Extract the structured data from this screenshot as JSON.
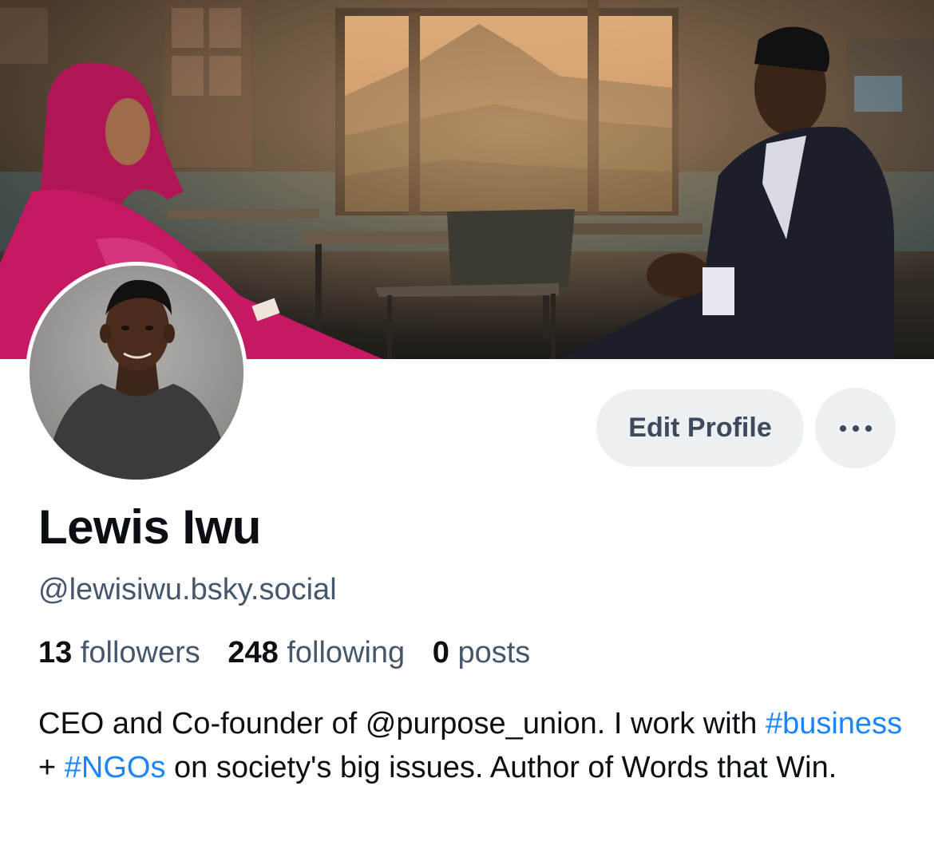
{
  "profile": {
    "display_name": "Lewis Iwu",
    "handle": "@lewisiwu.bsky.social",
    "edit_button_label": "Edit Profile",
    "more_button_label": "•••",
    "stats": {
      "followers_count": "13",
      "followers_label": "followers",
      "following_count": "248",
      "following_label": "following",
      "posts_count": "0",
      "posts_label": "posts"
    },
    "bio": {
      "line_part1": "CEO and Co-founder of @purpose_union. I work with ",
      "tag_business": "#business",
      "plus": " + ",
      "tag_ngos": "#NGOs",
      "line_part2": " on society's big issues. Author of Words that Win."
    }
  },
  "colors": {
    "accent_link": "#1a85ff",
    "button_bg": "#edf0f3",
    "secondary_text": "#46566b",
    "primary_text": "#0b0f14"
  },
  "icons": {
    "more": "ellipsis-icon"
  }
}
